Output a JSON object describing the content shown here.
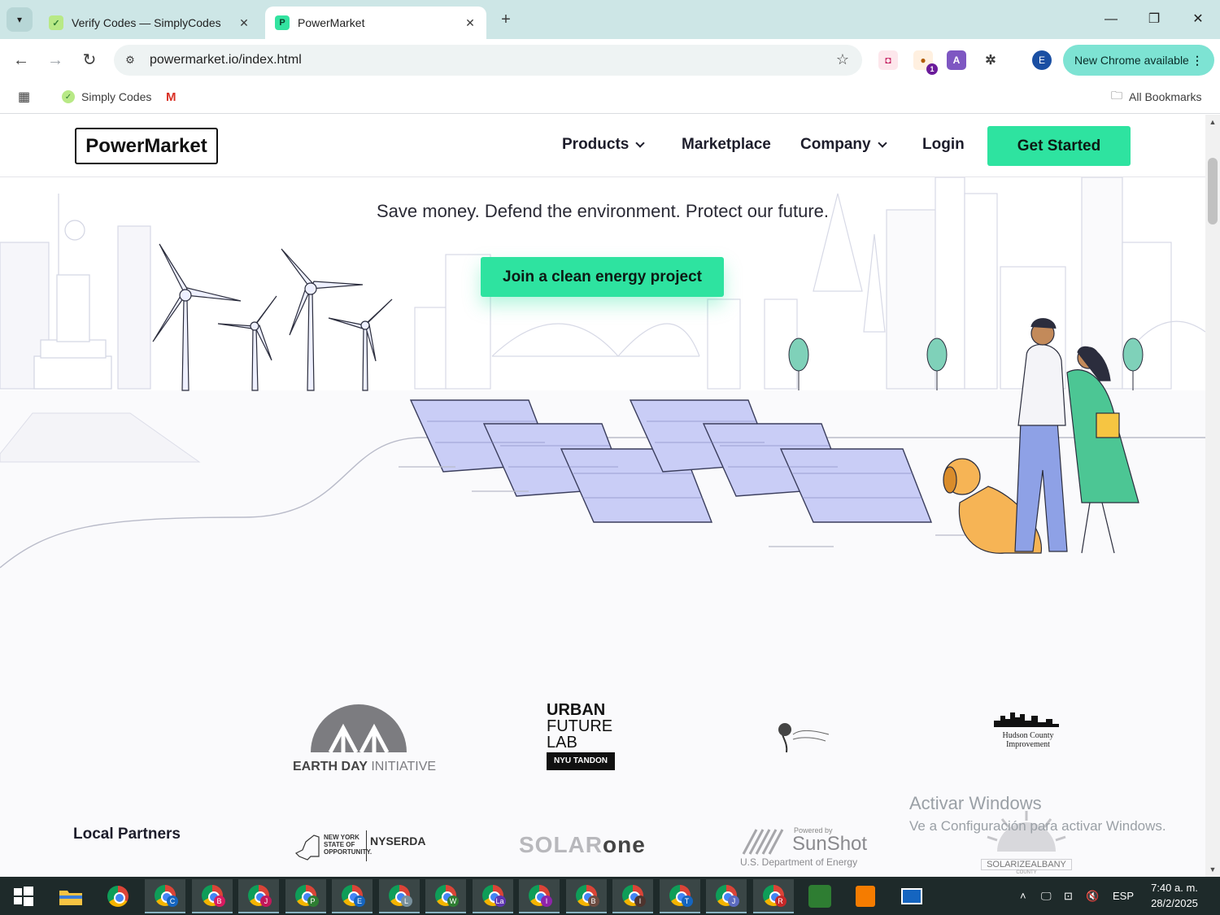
{
  "browser": {
    "tabs": [
      {
        "title": "Verify Codes — SimplyCodes",
        "favicon": "simplycodes-icon",
        "active": false
      },
      {
        "title": "PowerMarket",
        "favicon": "powermarket-icon",
        "active": true
      }
    ],
    "address": "powermarket.io/index.html",
    "update_label": "New Chrome available",
    "profile_initial": "E",
    "ext_badge": "1",
    "bookmarks": [
      {
        "label": "Simply Codes"
      },
      {
        "label": "All Bookmarks"
      }
    ]
  },
  "site": {
    "logo": "PowerMarket",
    "nav": {
      "products": "Products",
      "marketplace": "Marketplace",
      "company": "Company",
      "login": "Login",
      "get_started": "Get Started"
    },
    "hero": {
      "tagline": "Save money. Defend the environment. Protect our future.",
      "cta": "Join a clean energy project"
    },
    "partners": {
      "earth_day": {
        "main": "EARTH DAY",
        "sub": "INITIATIVE"
      },
      "urban_future": {
        "line1": "URBAN",
        "line2": "FUTURE",
        "line3": "LAB",
        "tag": "NYU TANDON"
      },
      "hudson": {
        "line1": "Hudson County",
        "line2": "Improvement"
      },
      "local_label": "Local Partners",
      "nyserda": {
        "state": "NEW YORK STATE OF OPPORTUNITY.",
        "name": "NYSERDA"
      },
      "solarone": {
        "light": "SOLAR",
        "bold": "one"
      },
      "sunshot": {
        "powered": "Powered by",
        "name": "SunShot",
        "dept": "U.S. Department of Energy"
      },
      "solarize": {
        "name": "SOLARIZEALBANY",
        "sub": "COUNTY"
      }
    }
  },
  "watermark": {
    "line1": "Activar Windows",
    "line2": "Ve a Configuración para activar Windows."
  },
  "taskbar": {
    "chrome_profiles": [
      "C",
      "B",
      "J",
      "P",
      "E",
      "L",
      "W",
      "La",
      "I",
      "B",
      "I",
      "T",
      "J",
      "R"
    ],
    "language": "ESP",
    "time": "7:40 a. m.",
    "date": "28/2/2025"
  },
  "colors": {
    "accent": "#2ee3a0",
    "tabstrip": "#cde6e6",
    "update_pill": "#7de3d3",
    "panel_blue": "#c9cdf6"
  }
}
